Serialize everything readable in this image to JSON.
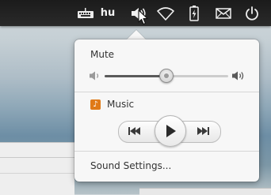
{
  "panel": {
    "keyboard_icon": "keyboard-icon",
    "keyboard_layout": "hu",
    "indicators": [
      "volume-icon",
      "network-wireless-icon",
      "battery-icon",
      "mail-icon",
      "power-icon"
    ]
  },
  "sound_menu": {
    "mute_label": "Mute",
    "volume_level": 0.5,
    "player_name": "Music",
    "player_icon": "music-note-icon",
    "controls": [
      "previous-icon",
      "play-icon",
      "next-icon"
    ],
    "settings_label": "Sound Settings..."
  },
  "colors": {
    "panel_bg": "#1b1b1b",
    "popover_bg": "#f7f7f7",
    "music_icon": "#e07a18"
  }
}
